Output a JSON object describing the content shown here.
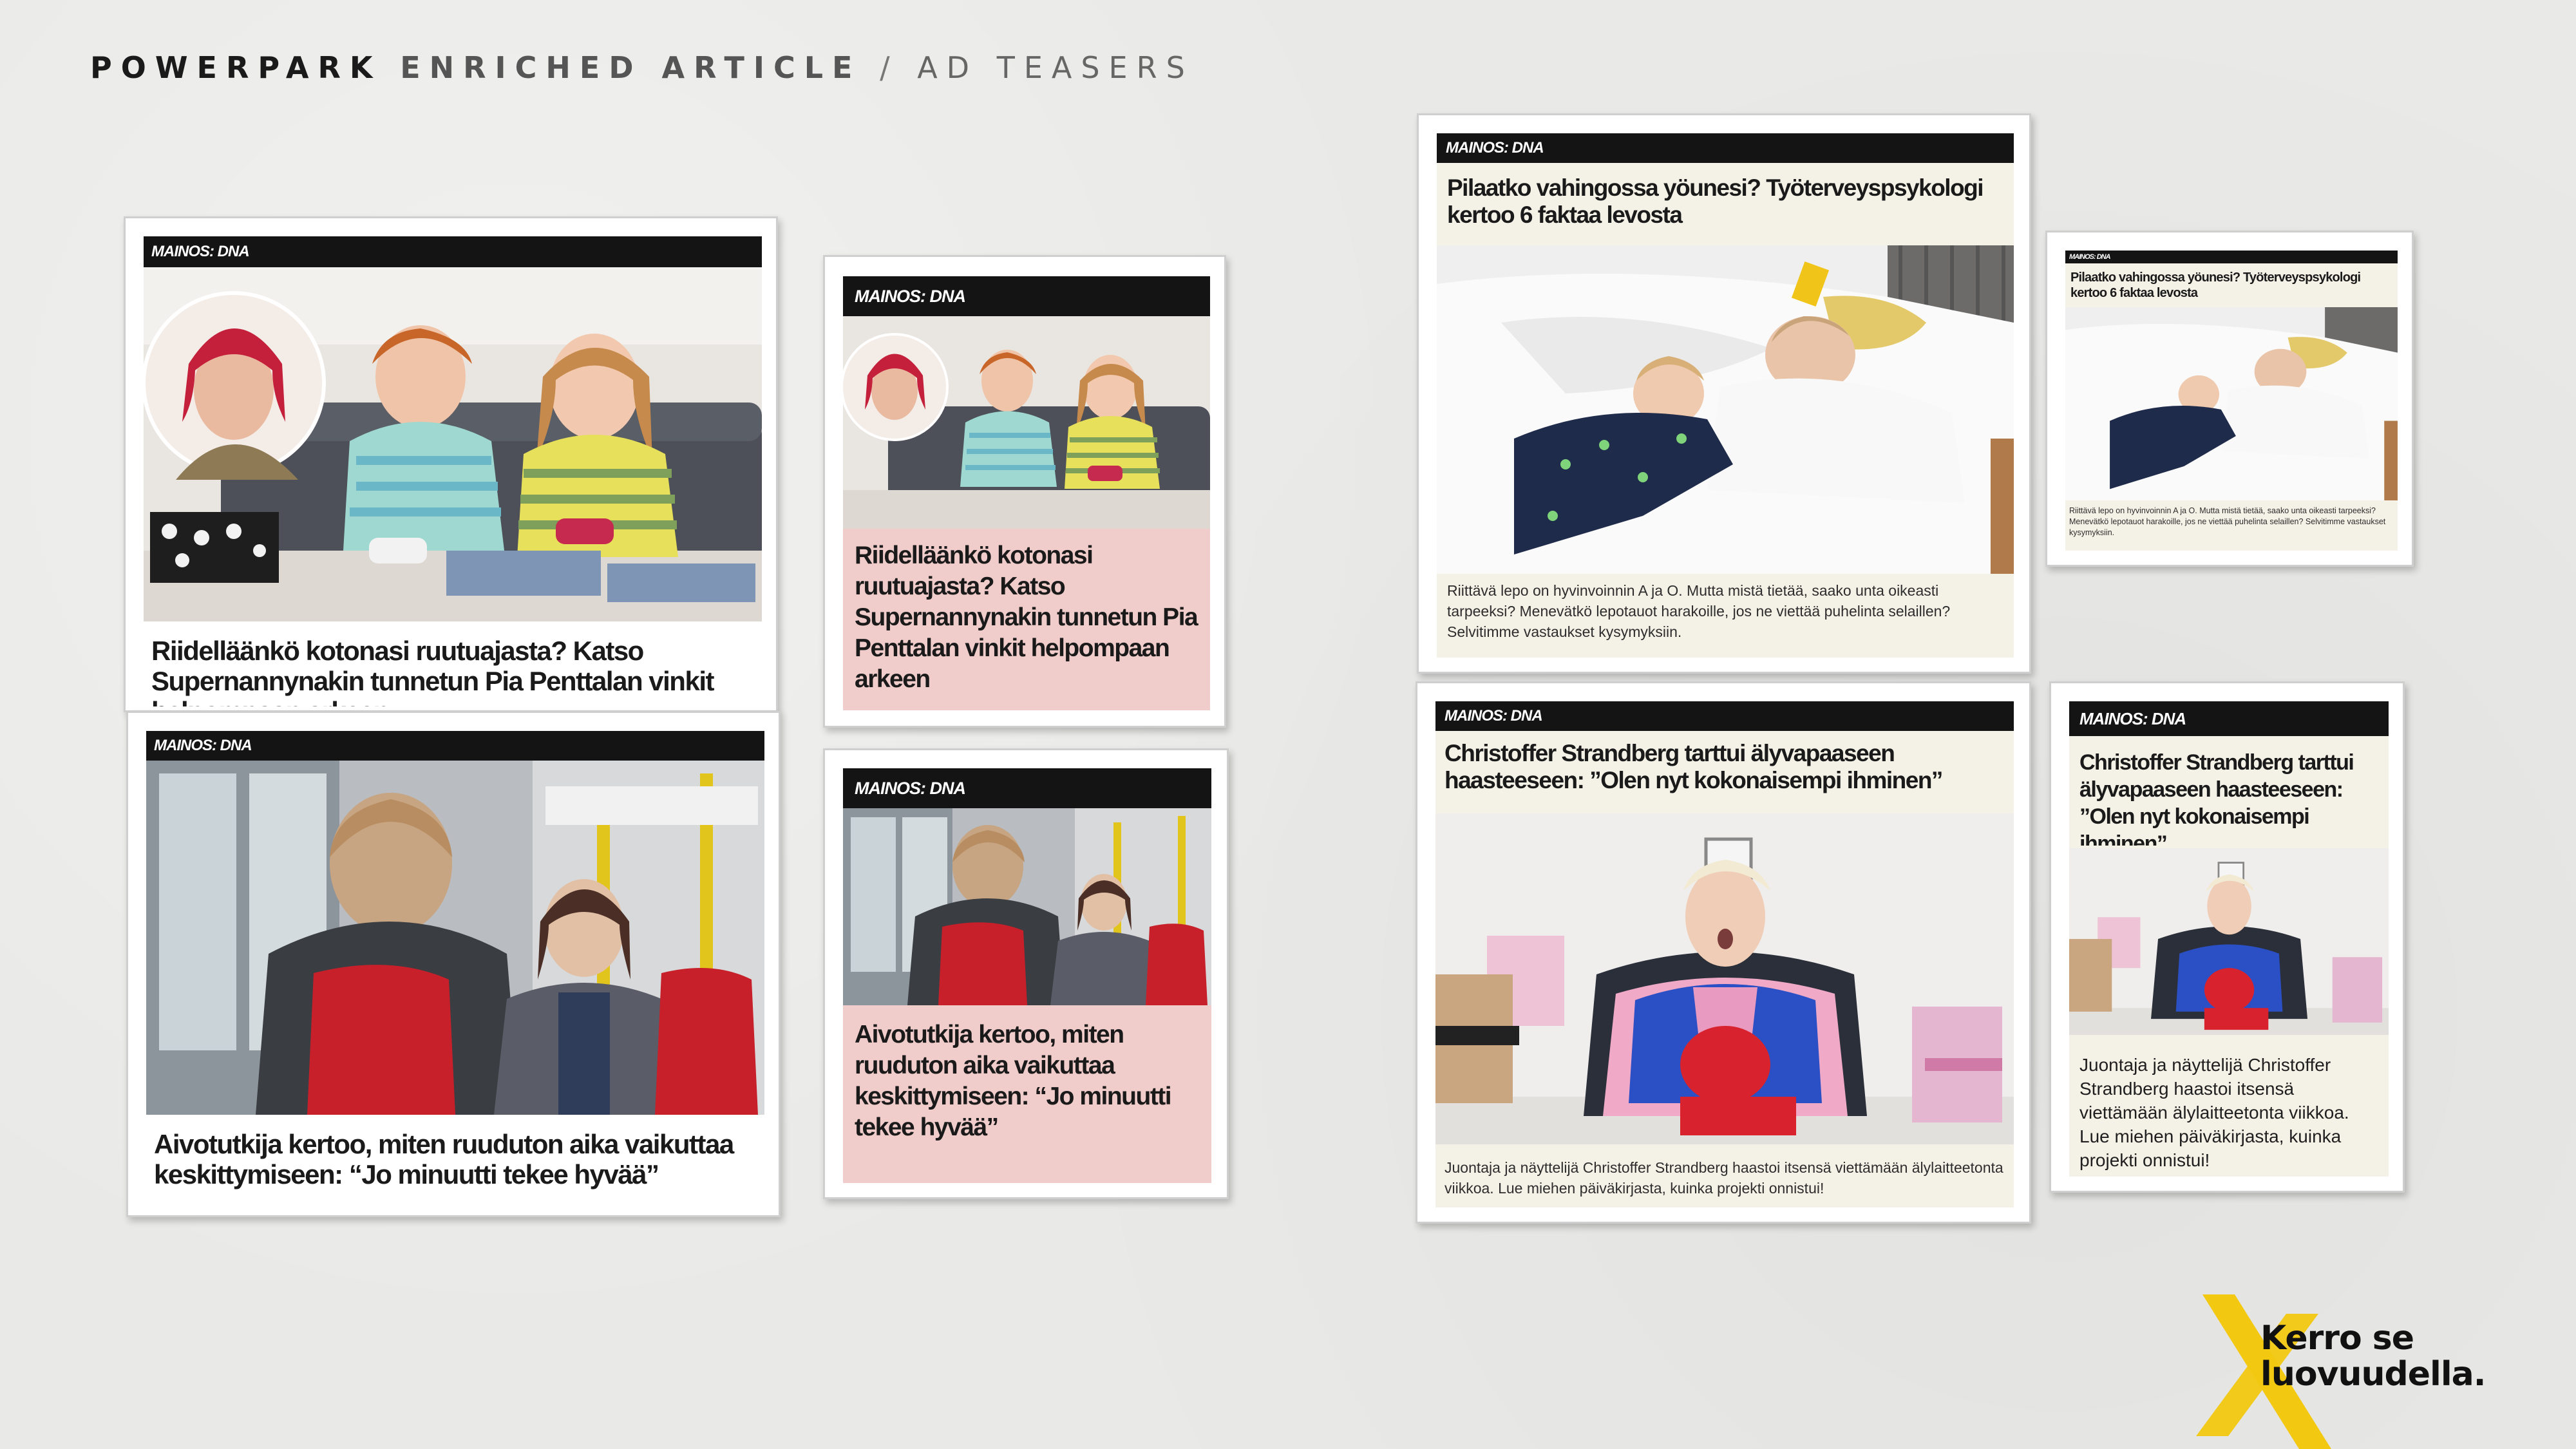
{
  "header": {
    "brand": "POWERPARK",
    "section": "ENRICHED ARTICLE",
    "separator": "/",
    "subsection": "AD TEASERS"
  },
  "label_text": "MAINOS: DNA",
  "teasers": {
    "large_1": {
      "label": "MAINOS: DNA",
      "title": "Riidelläänkö kotonasi ruutuajasta? Katso Supernannynakin tunnetun Pia Penttalan vinkit helpompaan arkeen"
    },
    "small_1": {
      "label": "MAINOS: DNA",
      "title": "Riidelläänkö kotonasi ruutuajasta? Katso Supernannynakin tunnetun Pia Penttalan vinkit helpompaan arkeen"
    },
    "large_2": {
      "label": "MAINOS: DNA",
      "title": "Aivotutkija kertoo, miten ruuduton aika vaikuttaa keskittymiseen: “Jo minuutti tekee hyvää”"
    },
    "small_2": {
      "label": "MAINOS: DNA",
      "title": "Aivotutkija kertoo, miten ruuduton aika vaikuttaa keskittymiseen: “Jo minuutti tekee hyvää”"
    },
    "large_3": {
      "label": "MAINOS: DNA",
      "title": "Pilaatko vahingossa yöunesi? Työterveyspsykologi kertoo 6 faktaa levosta",
      "desc": "Riittävä lepo on hyvinvoinnin A ja O. Mutta mistä tietää, saako unta oikeasti tarpeeksi? Menevätkö lepotauot harakoille, jos ne viettää puhelinta selaillen? Selvitimme vastaukset kysymyksiin."
    },
    "small_3": {
      "label": "MAINOS: DNA",
      "title": "Pilaatko vahingossa yöunesi? Työterveyspsykologi kertoo 6 faktaa levosta",
      "desc": "Riittävä lepo on hyvinvoinnin A ja O. Mutta mistä tietää, saako unta oikeasti tarpeeksi? Menevätkö lepotauot harakoille, jos ne viettää puhelinta selaillen? Selvitimme vastaukset kysymyksiin."
    },
    "large_4": {
      "label": "MAINOS: DNA",
      "title": "Christoffer Strandberg tarttui älyvapaaseen haasteeseen: ”Olen nyt kokonaisempi ihminen”",
      "desc": "Juontaja ja näyttelijä Christoffer Strandberg haastoi itsensä viettämään älylaitteetonta viikkoa. Lue miehen päiväkirjasta, kuinka projekti onnistui!"
    },
    "small_4": {
      "label": "MAINOS: DNA",
      "title": "Christoffer Strandberg tarttui älyvapaaseen haasteeseen: ”Olen nyt kokonaisempi ihminen”",
      "desc": "Juontaja ja näyttelijä Christoffer Strandberg haastoi itsensä viettämään älylaitteetonta viikkoa. Lue miehen päiväkirjasta, kuinka projekti onnistui!"
    }
  },
  "logo": {
    "line1": "Kerro se",
    "line2": "luovuudella."
  },
  "colors": {
    "label_bg": "#141414",
    "pink_panel": "#f0cdcb",
    "cream_panel": "#f4f1e6",
    "logo_x": "#f2c811"
  }
}
